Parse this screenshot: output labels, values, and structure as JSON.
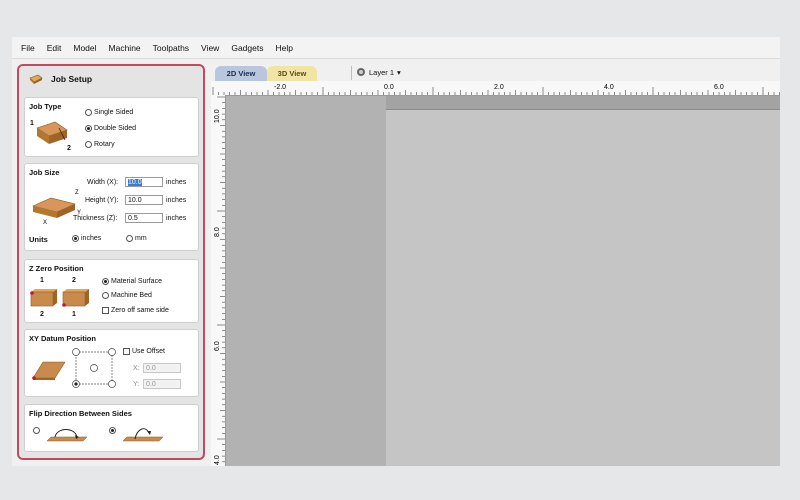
{
  "menu": [
    "File",
    "Edit",
    "Model",
    "Machine",
    "Toolpaths",
    "View",
    "Gadgets",
    "Help"
  ],
  "panel": {
    "title": "Job Setup",
    "job_type": {
      "title": "Job Type",
      "options": [
        "Single Sided",
        "Double Sided",
        "Rotary"
      ],
      "selected": "Double Sided",
      "diagram_labels": [
        "1",
        "2"
      ]
    },
    "job_size": {
      "title": "Job Size",
      "width_label": "Width (X):",
      "width_value": "10.0",
      "height_label": "Height (Y):",
      "height_value": "10.0",
      "thickness_label": "Thickness (Z):",
      "thickness_value": "0.5",
      "unit": "inches",
      "units_label": "Units",
      "units_options": [
        "inches",
        "mm"
      ],
      "units_selected": "inches"
    },
    "z_zero": {
      "title": "Z Zero Position",
      "options": [
        "Material Surface",
        "Machine Bed"
      ],
      "selected": "Material Surface",
      "checkbox_label": "Zero off same side",
      "diagram_labels": [
        "1",
        "2",
        "2",
        "1"
      ]
    },
    "xy_datum": {
      "title": "XY Datum Position",
      "use_offset_label": "Use Offset",
      "x_label": "X:",
      "x_value": "0.0",
      "y_label": "Y:",
      "y_value": "0.0"
    },
    "flip": {
      "title": "Flip Direction Between Sides"
    }
  },
  "view_tabs": [
    "2D View",
    "3D View"
  ],
  "active_tab": "2D View",
  "layer_label": "Layer 1",
  "ruler_top_labels": [
    "-2.0",
    "0.0",
    "2.0",
    "4.0",
    "6.0"
  ],
  "ruler_left_labels": [
    "10.0",
    "8.0",
    "6.0",
    "4.0"
  ],
  "colors": {
    "panel_border": "#c24a60",
    "tab_2d": "#b8c7de",
    "tab_3d": "#f1e5a6",
    "material": "#c98a4e"
  }
}
